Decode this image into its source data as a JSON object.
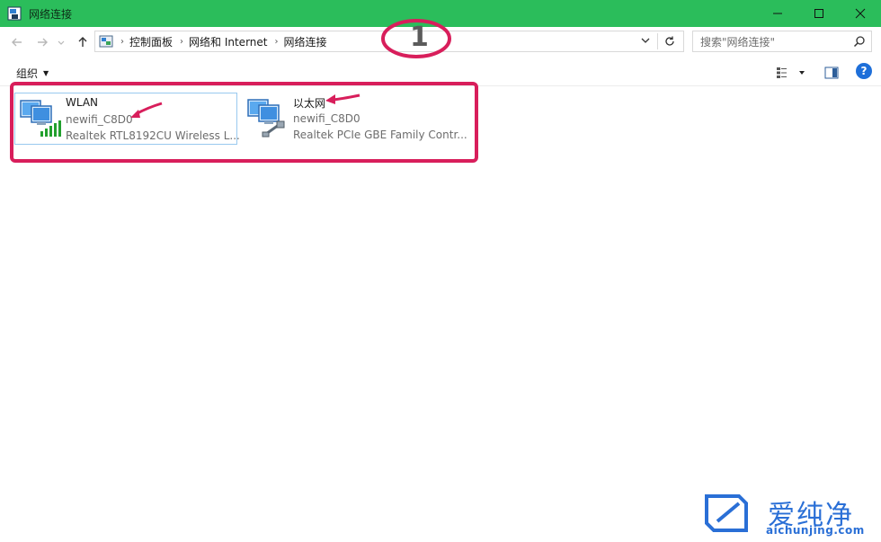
{
  "window": {
    "title": "网络连接",
    "controls": [
      "minimize",
      "maximize",
      "close"
    ]
  },
  "nav": {
    "breadcrumbs": [
      "控制面板",
      "网络和 Internet",
      "网络连接"
    ],
    "search_placeholder": "搜索\"网络连接\""
  },
  "toolbar": {
    "organize_label": "组织"
  },
  "connections": [
    {
      "name": "WLAN",
      "network": "newifi_C8D0",
      "adapter": "Realtek RTL8192CU Wireless L...",
      "icon": "wireless-network-icon"
    },
    {
      "name": "以太网",
      "network": "newifi_C8D0",
      "adapter": "Realtek PCIe GBE Family Contr...",
      "icon": "ethernet-network-icon"
    }
  ],
  "annotation": {
    "step_number": "1"
  },
  "watermark": {
    "cn": "爱纯净",
    "en": "aichunjing.com"
  },
  "colors": {
    "titlebar": "#2bbd5b",
    "annotation": "#d81e5b",
    "watermark": "#2a6fd6"
  }
}
